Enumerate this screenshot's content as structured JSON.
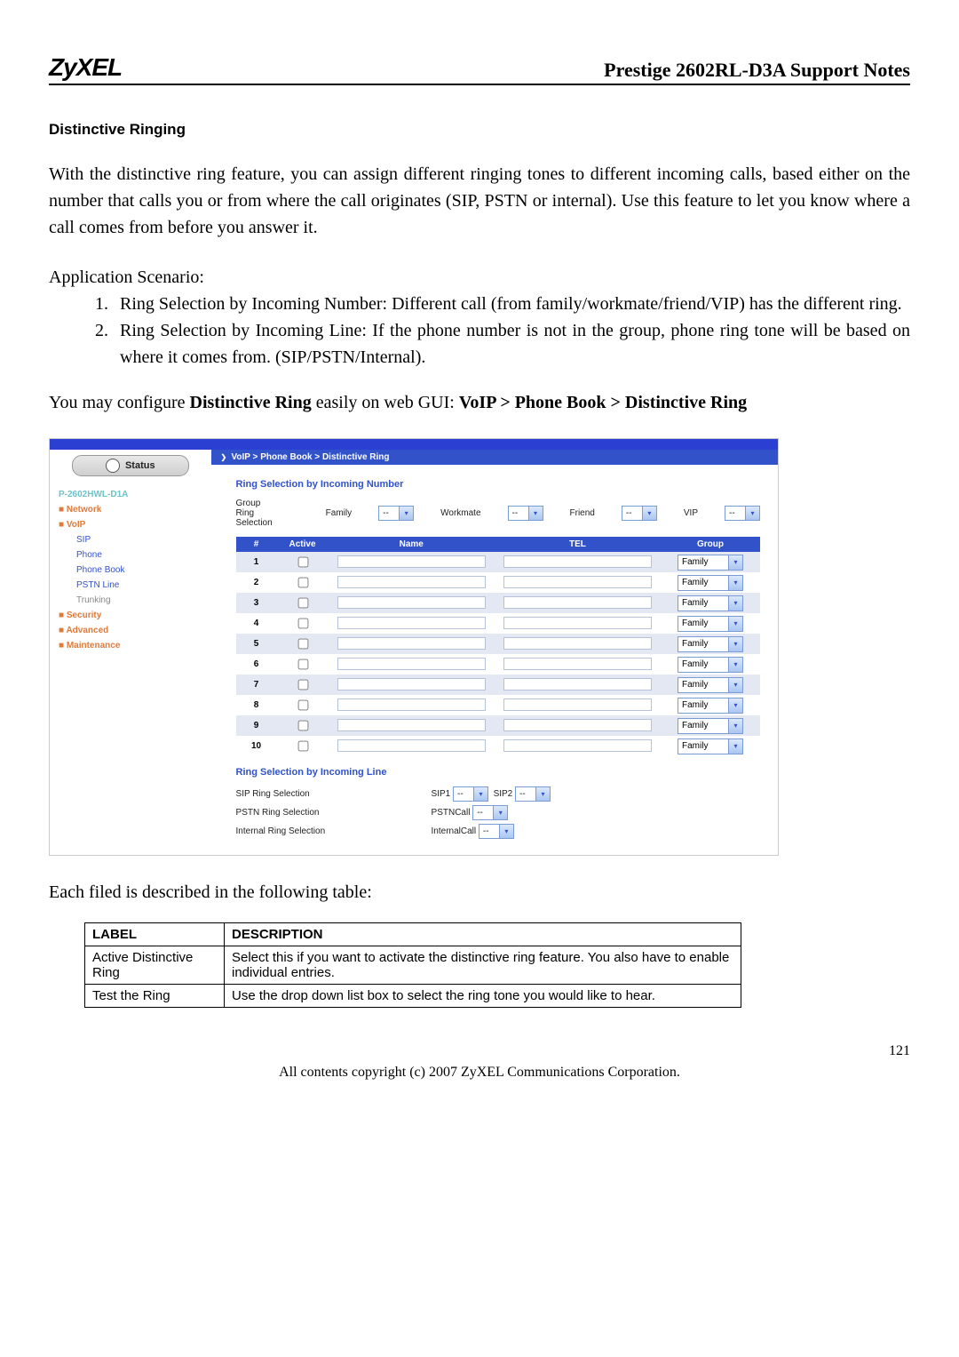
{
  "header": {
    "logo": "ZyXEL",
    "title": "Prestige 2602RL-D3A Support Notes"
  },
  "section_title": "Distinctive Ringing",
  "intro": "With the distinctive ring feature, you can assign different ringing tones to different incoming calls, based either on the number that calls you or from where the call originates (SIP, PSTN or internal). Use this feature to let you know where a call comes from before you answer it.",
  "scenario_label": "Application Scenario:",
  "scenarios": [
    "Ring Selection by Incoming Number: Different call (from family/workmate/friend/VIP) has the different ring.",
    "Ring Selection by Incoming Line: If the phone number is not in the group, phone ring tone will be based on where it comes from. (SIP/PSTN/Internal)."
  ],
  "config_prefix": "You may configure ",
  "config_bold1": "Distinctive Ring",
  "config_mid": " easily on web GUI: ",
  "config_bold2": "VoIP > Phone Book > Distinctive Ring",
  "shot": {
    "status_label": "Status",
    "model": "P-2602HWL-D1A",
    "nav": {
      "network": "Network",
      "voip": "VoIP",
      "sip": "SIP",
      "phone": "Phone",
      "phonebook": "Phone Book",
      "pstn": "PSTN Line",
      "trunking": "Trunking",
      "security": "Security",
      "advanced": "Advanced",
      "maintenance": "Maintenance"
    },
    "breadcrumb": {
      "a": "VoIP",
      "b": "Phone Book",
      "c": "Distinctive Ring"
    },
    "panel1_title": "Ring Selection by Incoming Number",
    "grs_label": "Group Ring Selection",
    "groups": {
      "family": "Family",
      "workmate": "Workmate",
      "friend": "Friend",
      "vip": "VIP",
      "selval": "--"
    },
    "th": {
      "num": "#",
      "active": "Active",
      "name": "Name",
      "tel": "TEL",
      "group": "Group"
    },
    "rows": [
      {
        "n": "1",
        "g": "Family"
      },
      {
        "n": "2",
        "g": "Family"
      },
      {
        "n": "3",
        "g": "Family"
      },
      {
        "n": "4",
        "g": "Family"
      },
      {
        "n": "5",
        "g": "Family"
      },
      {
        "n": "6",
        "g": "Family"
      },
      {
        "n": "7",
        "g": "Family"
      },
      {
        "n": "8",
        "g": "Family"
      },
      {
        "n": "9",
        "g": "Family"
      },
      {
        "n": "10",
        "g": "Family"
      }
    ],
    "panel2_title": "Ring Selection by Incoming Line",
    "line": {
      "sip_label": "SIP Ring Selection",
      "pstn_label": "PSTN Ring Selection",
      "internal_label": "Internal Ring Selection",
      "sip1": "SIP1",
      "sip2": "SIP2",
      "pstn": "PSTNCall",
      "internal": "InternalCall",
      "selval": "--"
    }
  },
  "post_shot": "Each filed is described in the following table:",
  "desc": {
    "h1": "LABEL",
    "h2": "DESCRIPTION",
    "r1l": "Active Distinctive Ring",
    "r1d": "Select this if you want to activate the distinctive ring feature. You also have to enable individual entries.",
    "r2l": "Test the Ring",
    "r2d": "Use the drop down list box to select the ring tone you would like to hear."
  },
  "page_num": "121",
  "footer": "All contents copyright (c) 2007 ZyXEL Communications Corporation."
}
